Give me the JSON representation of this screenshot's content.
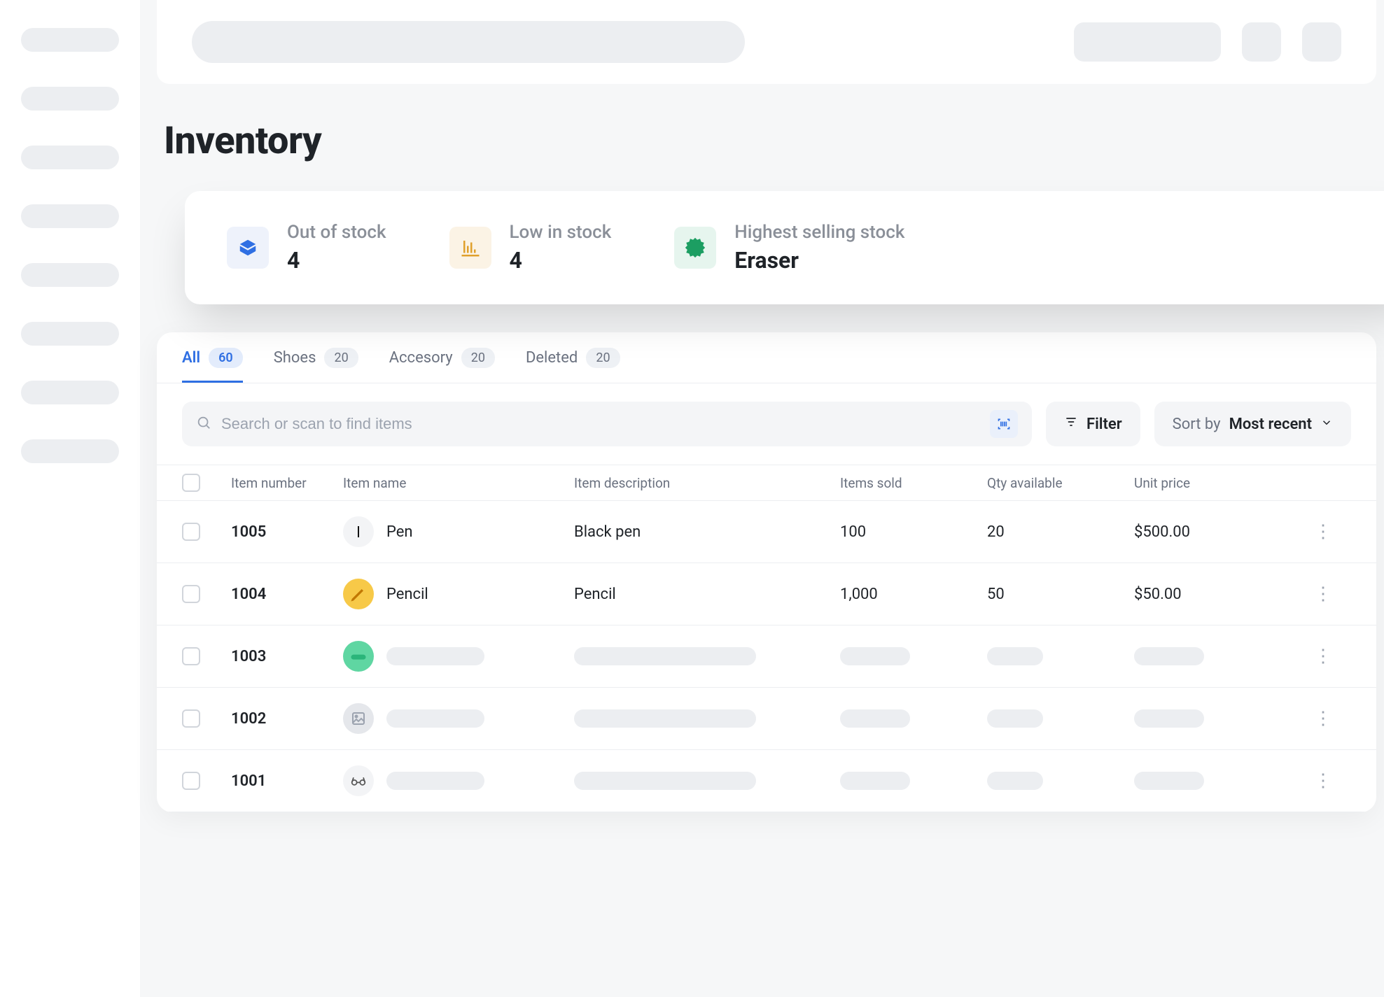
{
  "page": {
    "title": "Inventory"
  },
  "summary": [
    {
      "icon": "box-icon",
      "label": "Out of stock",
      "value": "4",
      "tone": "blue"
    },
    {
      "icon": "trend-down-icon",
      "label": "Low in stock",
      "value": "4",
      "tone": "orange"
    },
    {
      "icon": "hot-badge-icon",
      "label": "Highest selling stock",
      "value": "Eraser",
      "tone": "green"
    }
  ],
  "tabs": [
    {
      "label": "All",
      "count": "60",
      "active": true
    },
    {
      "label": "Shoes",
      "count": "20",
      "active": false
    },
    {
      "label": "Accesory",
      "count": "20",
      "active": false
    },
    {
      "label": "Deleted",
      "count": "20",
      "active": false
    }
  ],
  "toolbar": {
    "search_placeholder": "Search or scan to find items",
    "filter_label": "Filter",
    "sort_label": "Sort by",
    "sort_value": "Most recent"
  },
  "columns": {
    "item_number": "Item number",
    "item_name": "Item name",
    "item_description": "Item description",
    "items_sold": "Items sold",
    "qty_available": "Qty available",
    "unit_price": "Unit price"
  },
  "rows": [
    {
      "item_number": "1005",
      "item_name": "Pen",
      "item_description": "Black pen",
      "items_sold": "100",
      "qty_available": "20",
      "unit_price": "$500.00",
      "thumb": "pen"
    },
    {
      "item_number": "1004",
      "item_name": "Pencil",
      "item_description": "Pencil",
      "items_sold": "1,000",
      "qty_available": "50",
      "unit_price": "$50.00",
      "thumb": "pencil"
    },
    {
      "item_number": "1003",
      "item_name": "",
      "item_description": "",
      "items_sold": "",
      "qty_available": "",
      "unit_price": "",
      "thumb": "green",
      "loading": true
    },
    {
      "item_number": "1002",
      "item_name": "",
      "item_description": "",
      "items_sold": "",
      "qty_available": "",
      "unit_price": "",
      "thumb": "img",
      "loading": true
    },
    {
      "item_number": "1001",
      "item_name": "",
      "item_description": "",
      "items_sold": "",
      "qty_available": "",
      "unit_price": "",
      "thumb": "glasses",
      "loading": true
    }
  ]
}
